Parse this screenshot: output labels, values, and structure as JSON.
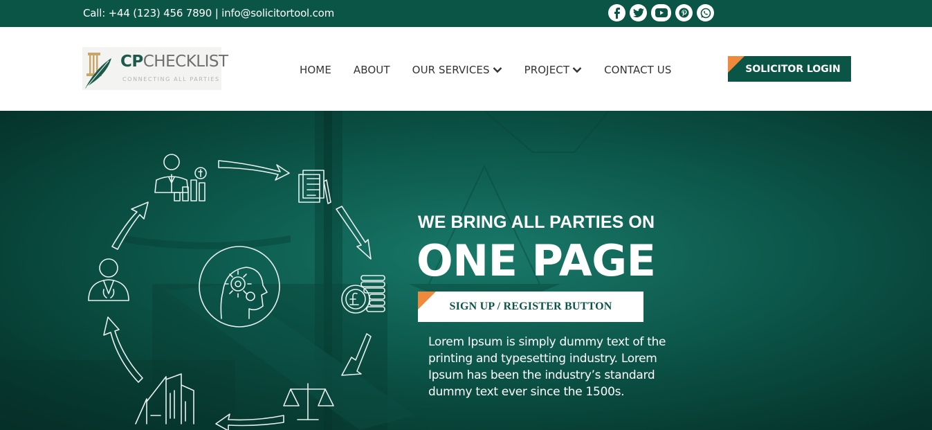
{
  "topbar": {
    "contact": "Call: +44 (123) 456 7890 | info@solicitortool.com",
    "socials": [
      "facebook-icon",
      "twitter-icon",
      "youtube-icon",
      "pinterest-icon",
      "whatsapp-icon"
    ]
  },
  "logo": {
    "brand_bold": "CP",
    "brand_rest": "CHECKLIST",
    "tagline": "CONNECTING ALL PARTIES"
  },
  "nav": {
    "home": "HOME",
    "about": "ABOUT",
    "services": "OUR SERVICES",
    "project": "PROJECT",
    "contact": "CONTACT US"
  },
  "login_label": "SOLICITOR LOGIN",
  "hero": {
    "subtitle": "WE BRING ALL PARTIES ON",
    "title": "ONE PAGE",
    "signup_label": "SIGN UP / REGISTER BUTTON",
    "body": "Lorem Ipsum is simply dummy text of the printing and typesetting industry. Lorem Ipsum has been the industry’s standard dummy text ever since the 1500s."
  },
  "colors": {
    "brand_green": "#0b5547",
    "accent_orange": "#ef8a3c",
    "hero_green": "#0f6a5b"
  }
}
